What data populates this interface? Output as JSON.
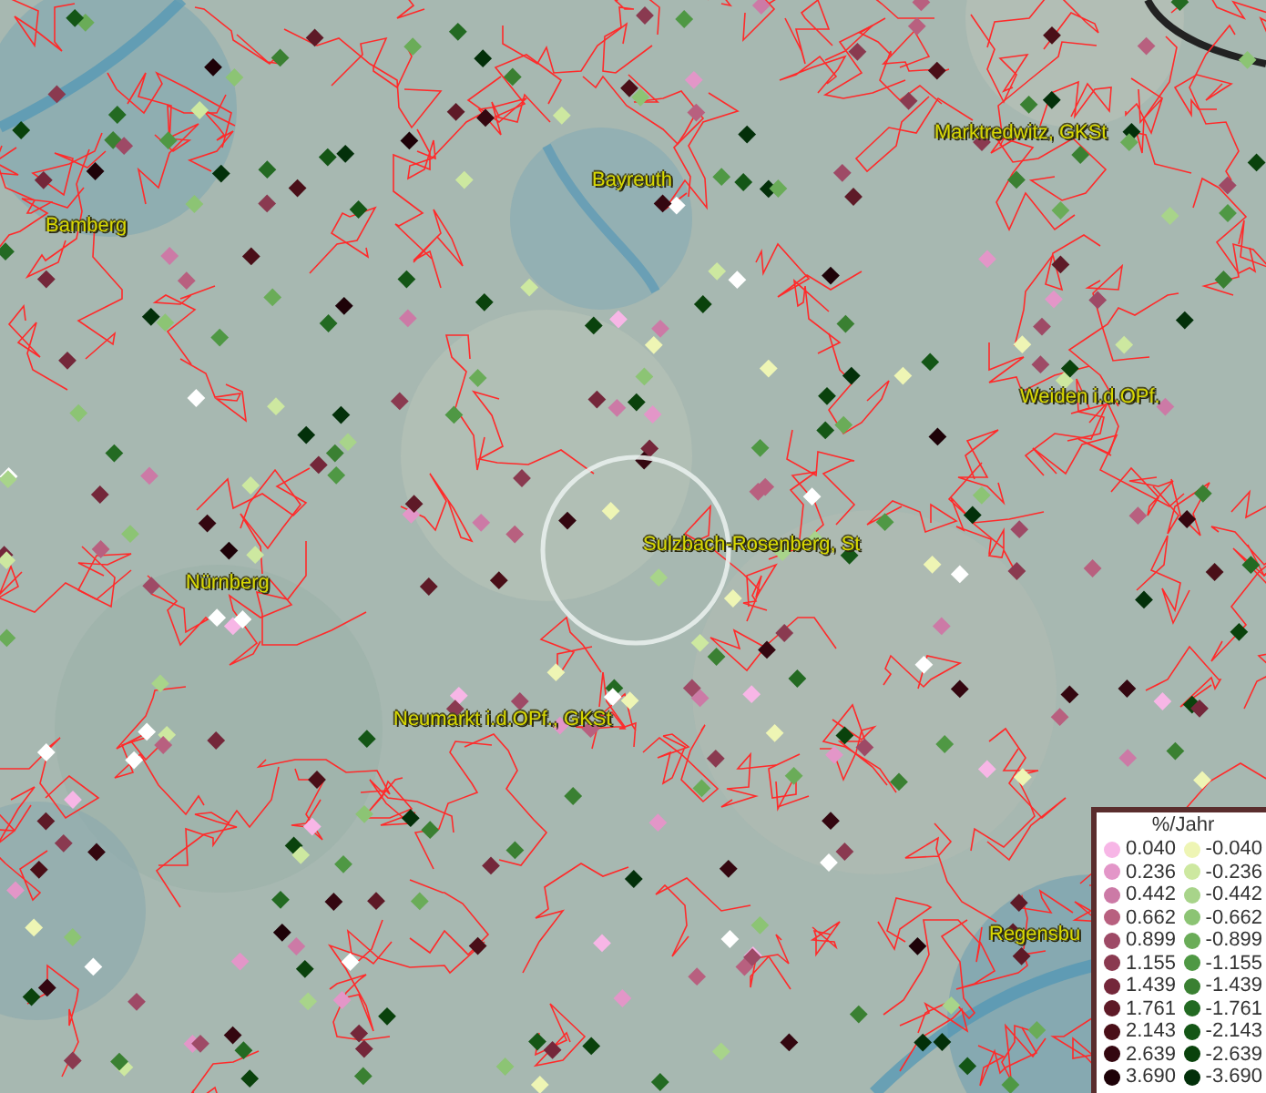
{
  "map_labels": [
    {
      "text": "Bamberg"
    },
    {
      "text": "Bayreuth"
    },
    {
      "text": "Marktredwitz, GKSt"
    },
    {
      "text": "Weiden i.d.OPf."
    },
    {
      "text": "Nürnberg"
    },
    {
      "text": "Sulzbach-Rosenberg, St"
    },
    {
      "text": "Neumarkt i.d.OPf., GKSt"
    },
    {
      "text": "Regensbu"
    }
  ],
  "legend": {
    "title": "%/Jahr",
    "items": [
      {
        "label": "0.040",
        "color": "#f7b6e6"
      },
      {
        "label": "-0.040",
        "color": "#eef5b4"
      },
      {
        "label": "0.236",
        "color": "#e396c8"
      },
      {
        "label": "-0.236",
        "color": "#cde8a0"
      },
      {
        "label": "0.442",
        "color": "#cc7aa6"
      },
      {
        "label": "-0.442",
        "color": "#a8d48a"
      },
      {
        "label": "0.662",
        "color": "#b8607f"
      },
      {
        "label": "-0.662",
        "color": "#8cc474"
      },
      {
        "label": "0.899",
        "color": "#9e4a66"
      },
      {
        "label": "-0.899",
        "color": "#6aac58"
      },
      {
        "label": "1.155",
        "color": "#8a3a50"
      },
      {
        "label": "-1.155",
        "color": "#4f9844"
      },
      {
        "label": "1.439",
        "color": "#74273a"
      },
      {
        "label": "-1.439",
        "color": "#3a8032"
      },
      {
        "label": "1.761",
        "color": "#5e1a27"
      },
      {
        "label": "-1.761",
        "color": "#236a22"
      },
      {
        "label": "2.143",
        "color": "#4a0f18"
      },
      {
        "label": "-2.143",
        "color": "#145616"
      },
      {
        "label": "2.639",
        "color": "#340710"
      },
      {
        "label": "-2.639",
        "color": "#0a420c"
      },
      {
        "label": "3.690",
        "color": "#1e0208"
      },
      {
        "label": "-3.690",
        "color": "#03300a"
      }
    ]
  }
}
